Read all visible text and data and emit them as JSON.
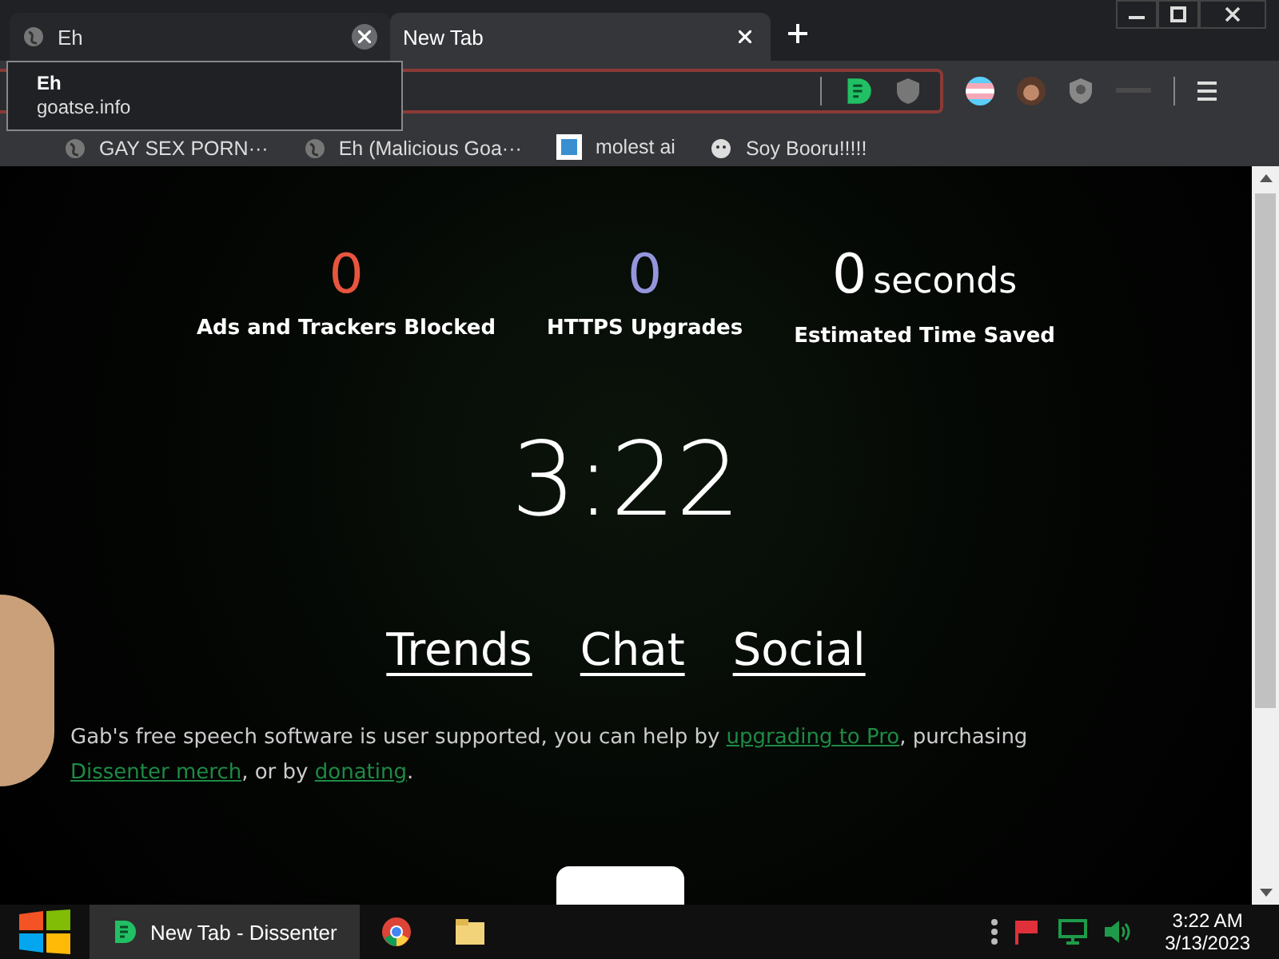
{
  "tabs": [
    {
      "title": "Eh",
      "selected": false
    },
    {
      "title": "New Tab",
      "selected": true
    }
  ],
  "tooltip": {
    "title": "Eh",
    "url": "goatse.info"
  },
  "bookmarks": [
    {
      "label": "GAY SEX PORN···",
      "kind": "globe"
    },
    {
      "label": "Eh (Malicious Goa···",
      "kind": "globe"
    },
    {
      "label": "molest ai",
      "kind": "image"
    },
    {
      "label": "Soy Booru!!!!!",
      "kind": "mascot"
    }
  ],
  "stats": [
    {
      "value": "0",
      "label": "Ads and Trackers Blocked",
      "color": "#e8553e"
    },
    {
      "value": "0",
      "label": "HTTPS Upgrades",
      "color": "#9496dc"
    },
    {
      "value": "0",
      "unit": "seconds",
      "label": "Estimated Time Saved",
      "color": "#ffffff"
    }
  ],
  "clock": "3:22",
  "nav_links": [
    "Trends",
    "Chat",
    "Social"
  ],
  "notice": [
    {
      "kind": "text",
      "text": "Gab's free speech software is user supported, you can help by "
    },
    {
      "kind": "link",
      "text": "upgrading to Pro"
    },
    {
      "kind": "text",
      "text": ", purchasing "
    },
    {
      "kind": "link",
      "text": "Dissenter merch"
    },
    {
      "kind": "text",
      "text": ", or by "
    },
    {
      "kind": "link",
      "text": "donating"
    },
    {
      "kind": "text",
      "text": "."
    }
  ],
  "taskbar": {
    "tasks": [
      {
        "label": "New Tab - Dissenter",
        "selected": true
      }
    ],
    "time": "3:22 AM",
    "date": "3/13/2023"
  }
}
